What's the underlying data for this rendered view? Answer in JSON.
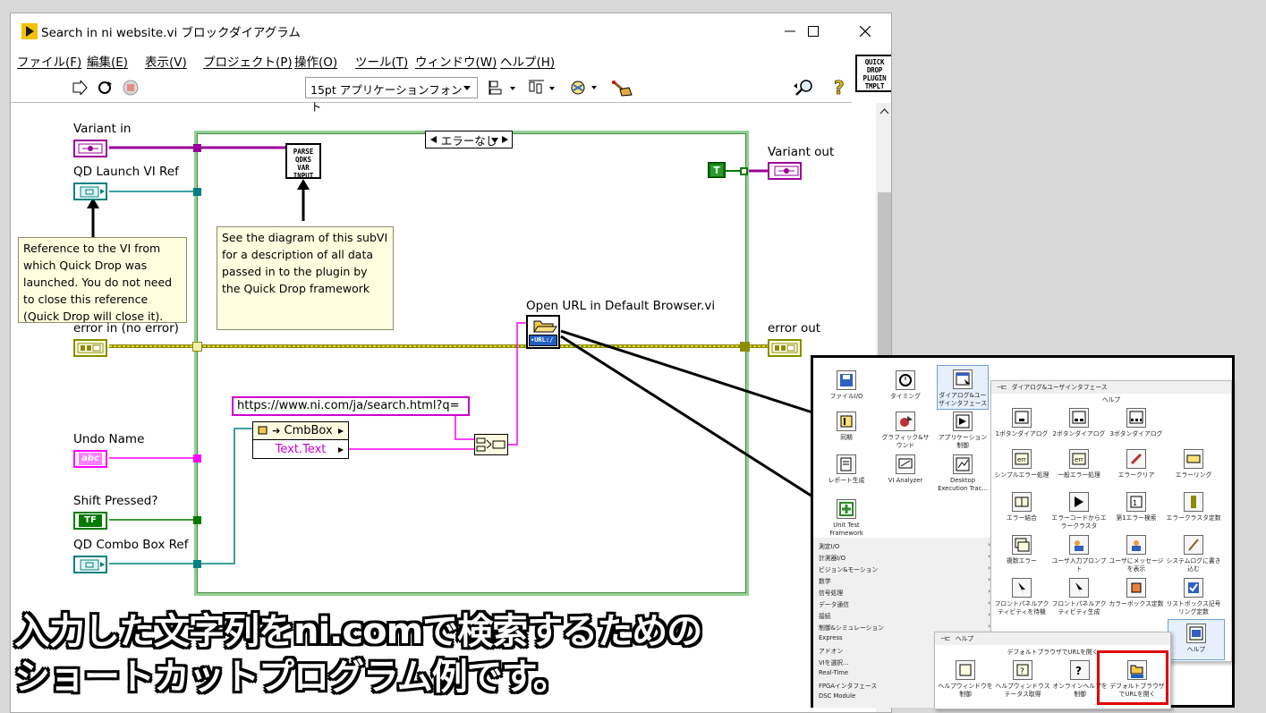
{
  "window": {
    "title": "Search in ni website.vi ブロックダイアグラム",
    "menu": [
      "ファイル(F)",
      "編集(E)",
      "表示(V)",
      "プロジェクト(P)",
      "操作(O)",
      "ツール(T)",
      "ウィンドウ(W)",
      "ヘルプ(H)"
    ],
    "font_select": "15pt アプリケーションフォント",
    "qd_logo": "QUICK DROP PLUGIN TMPLT"
  },
  "diagram": {
    "inputs": {
      "variant_in": "Variant in",
      "qd_launch_ref": "QD Launch VI Ref",
      "error_in": "error in (no error)",
      "undo_name": "Undo Name",
      "shift_pressed": "Shift Pressed?",
      "qd_combo_ref": "QD Combo Box Ref"
    },
    "outputs": {
      "variant_out": "Variant out",
      "error_out": "error out"
    },
    "notes": {
      "ref_note": "Reference to the VI from which Quick Drop was launched.  You do not need to close this reference (Quick Drop will close it).",
      "subvi_note": "See the diagram of this subVI for a description of all data passed in to the plugin by the Quick Drop framework"
    },
    "parse_subvi": "PARSE QDKS VAR INPUT",
    "case_selector": "エラーなし",
    "true_const": "T",
    "open_url_label": "Open URL in Default Browser.vi",
    "url_constant": "https://www.ni.com/ja/search.html?q=",
    "prop_node_class": "CmbBox",
    "prop_node_prop": "Text.Text",
    "string_indicator_text": "abc",
    "bool_term_text": "TF"
  },
  "palette": {
    "top_items": [
      "ファイルI/O",
      "タイミング",
      "ダイアログ&ユーザインタフェース",
      "同期",
      "グラフィック&サウンド",
      "アプリケーション制御",
      "レポート生成",
      "VI Analyzer",
      "Desktop Execution Trac...",
      "Unit Test Framework"
    ],
    "categories": [
      "測定I/O",
      "計測器I/O",
      "ビジョン&モーション",
      "数学",
      "信号処理",
      "データ通信",
      "接続",
      "制御&シミュレーション",
      "Express",
      "アドオン",
      "VIを選択...",
      "Real-Time",
      "FPGAインタフェース",
      "DSC Module"
    ],
    "sub_title": "ダイアログ&ユーザインタフェース",
    "sub_section": "ヘルプ",
    "sub_items": [
      "1ボタンダイアログ",
      "2ボタンダイアログ",
      "3ボタンダイアログ",
      "",
      "シンプルエラー処理",
      "一般エラー処理",
      "エラークリア",
      "エラーリング",
      "エラー結合",
      "エラーコードからエラークラスタ",
      "第1エラー検索",
      "エラークラスタ定数",
      "複数エラー",
      "ユーザ入力プロンプト",
      "ユーザにメッセージを表示",
      "システムログに書き込む",
      "フロントパネルアクティビティを待機",
      "フロントパネルアクティビティ生成",
      "カラーボックス定数",
      "リストボックス記号リング定数"
    ],
    "help_tile": "ヘルプ",
    "help_title": "ヘルプ",
    "help_hover": "デフォルトブラウザでURLを開く",
    "help_items": [
      "ヘルプウィンドウを制御",
      "ヘルプウィンドウステータス取得",
      "オンラインヘルプを制御",
      "デフォルトブラウザでURLを開く"
    ]
  },
  "caption": {
    "line1": "入力した文字列をni.comで検索するための",
    "line2": "ショートカットプログラム例です。"
  },
  "colors": {
    "variant": "#990099",
    "refnum": "#008080",
    "error": "#8c8c00",
    "string": "#ff00ff",
    "boolean": "#007a00",
    "case_frame": "#90d090",
    "highlight": "#e00000"
  }
}
